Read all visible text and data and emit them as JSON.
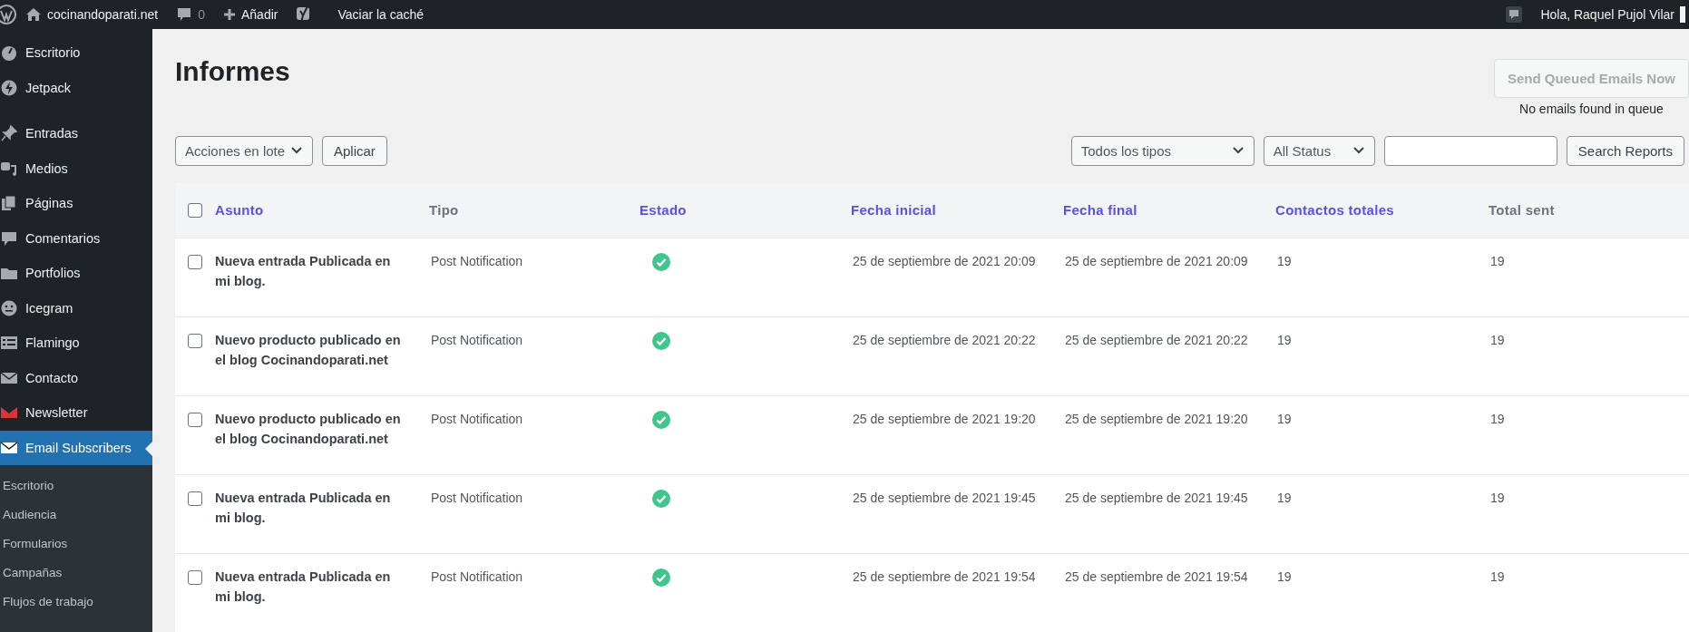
{
  "admin_bar": {
    "site": "cocinandoparati.net",
    "comments": "0",
    "add_new": "Añadir",
    "clear_cache": "Vaciar la caché",
    "greeting": "Hola, Raquel Pujol Vilar"
  },
  "sidebar": {
    "items": [
      {
        "label": "Escritorio",
        "kind": "gauge",
        "selected": false
      },
      {
        "label": "Jetpack",
        "kind": "bolt",
        "selected": false
      },
      {
        "label": "Entradas",
        "kind": "pin",
        "selected": false
      },
      {
        "label": "Medios",
        "kind": "media",
        "selected": false
      },
      {
        "label": "Páginas",
        "kind": "pages",
        "selected": false
      },
      {
        "label": "Comentarios",
        "kind": "comment",
        "selected": false
      },
      {
        "label": "Portfolios",
        "kind": "folder",
        "selected": false
      },
      {
        "label": "Icegram",
        "kind": "face",
        "selected": false
      },
      {
        "label": "Flamingo",
        "kind": "list",
        "selected": false
      },
      {
        "label": "Contacto",
        "kind": "mail",
        "selected": false
      },
      {
        "label": "Newsletter",
        "kind": "newsletter",
        "selected": false
      },
      {
        "label": "Email Subscribers",
        "kind": "mail",
        "selected": true
      }
    ],
    "submenu": [
      "Escritorio",
      "Audiencia",
      "Formularios",
      "Campañas",
      "Flujos de trabajo"
    ]
  },
  "page": {
    "title": "Informes",
    "send_button": "Send Queued Emails Now",
    "queue_note": "No emails found in queue"
  },
  "toolbar": {
    "bulk_actions": "Acciones en lote",
    "apply": "Aplicar",
    "type_filter": "Todos los tipos",
    "status_filter": "All Status",
    "search_button": "Search Reports"
  },
  "table": {
    "select_all_checked": false,
    "columns": [
      {
        "label": "Asunto",
        "sortable": true
      },
      {
        "label": "Tipo",
        "sortable": false
      },
      {
        "label": "Estado",
        "sortable": true
      },
      {
        "label": "Fecha inicial",
        "sortable": true
      },
      {
        "label": "Fecha final",
        "sortable": true
      },
      {
        "label": "Contactos totales",
        "sortable": true
      },
      {
        "label": "Total sent",
        "sortable": false
      }
    ],
    "rows": [
      {
        "checked": false,
        "subject": "Nueva entrada Publicada en mi blog.",
        "type": "Post Notification",
        "success": true,
        "start": "25 de septiembre de 2021 20:09",
        "end": "25 de septiembre de 2021 20:09",
        "contacts": "19",
        "sent": "19"
      },
      {
        "checked": false,
        "subject": "Nuevo producto publicado en el blog Cocinandoparati.net",
        "type": "Post Notification",
        "success": true,
        "start": "25 de septiembre de 2021 20:22",
        "end": "25 de septiembre de 2021 20:22",
        "contacts": "19",
        "sent": "19"
      },
      {
        "checked": false,
        "subject": "Nuevo producto publicado en el blog Cocinandoparati.net",
        "type": "Post Notification",
        "success": true,
        "start": "25 de septiembre de 2021 19:20",
        "end": "25 de septiembre de 2021 19:20",
        "contacts": "19",
        "sent": "19"
      },
      {
        "checked": false,
        "subject": "Nueva entrada Publicada en mi blog.",
        "type": "Post Notification",
        "success": true,
        "start": "25 de septiembre de 2021 19:45",
        "end": "25 de septiembre de 2021 19:45",
        "contacts": "19",
        "sent": "19"
      },
      {
        "checked": false,
        "subject": "Nueva entrada Publicada en mi blog.",
        "type": "Post Notification",
        "success": true,
        "start": "25 de septiembre de 2021 19:54",
        "end": "25 de septiembre de 2021 19:54",
        "contacts": "19",
        "sent": "19"
      }
    ]
  }
}
